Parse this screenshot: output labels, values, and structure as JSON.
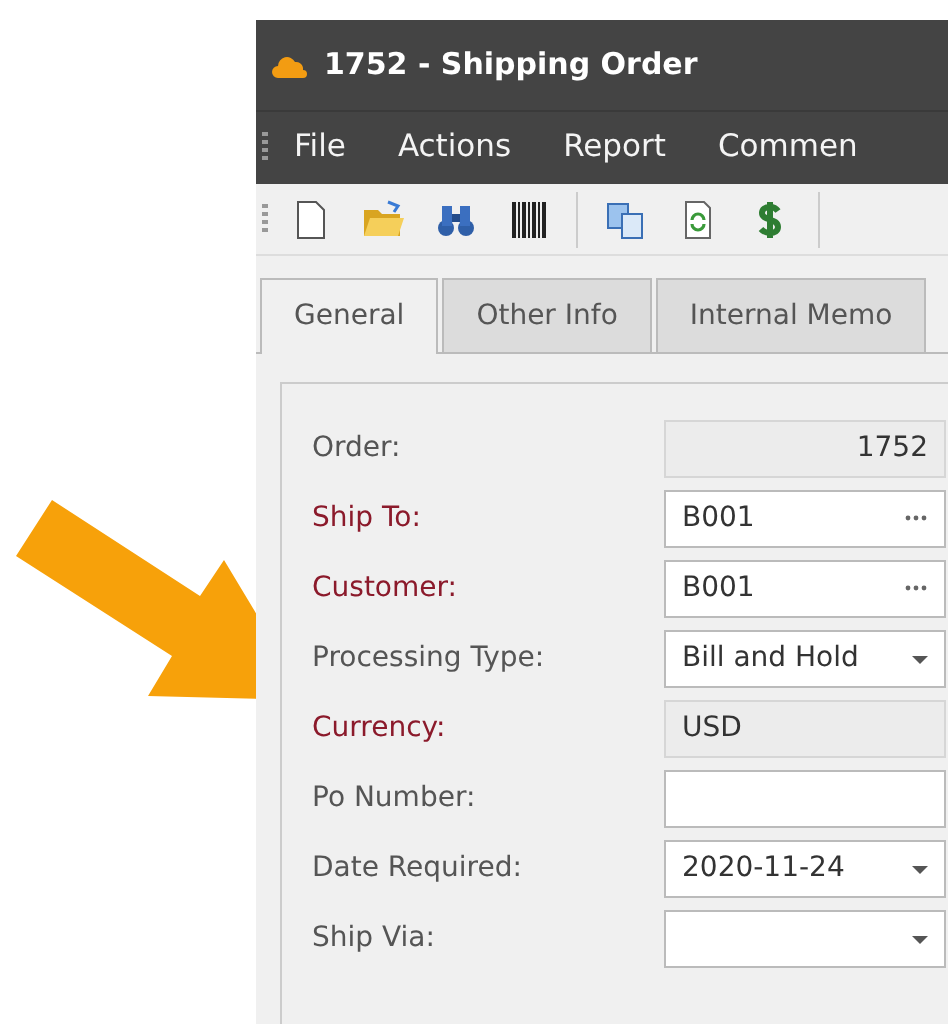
{
  "window": {
    "title": "1752 - Shipping Order"
  },
  "menu": [
    "File",
    "Actions",
    "Report",
    "Commen"
  ],
  "tabs": [
    {
      "label": "General",
      "selected": true
    },
    {
      "label": "Other Info",
      "selected": false
    },
    {
      "label": "Internal Memo",
      "selected": false
    }
  ],
  "fields": [
    {
      "label": "Order:",
      "required": false,
      "kind": "readonly",
      "value": "1752"
    },
    {
      "label": "Ship To:",
      "required": true,
      "kind": "lookup",
      "value": "B001"
    },
    {
      "label": "Customer:",
      "required": true,
      "kind": "lookup",
      "value": "B001"
    },
    {
      "label": "Processing Type:",
      "required": false,
      "kind": "dropdown",
      "value": "Bill and Hold"
    },
    {
      "label": "Currency:",
      "required": true,
      "kind": "readonly-left",
      "value": "USD"
    },
    {
      "label": "Po Number:",
      "required": false,
      "kind": "text"
    },
    {
      "label": "Date Required:",
      "required": false,
      "kind": "dropdown",
      "value": "2020-11-24"
    },
    {
      "label": "Ship Via:",
      "required": false,
      "kind": "dropdown"
    }
  ]
}
